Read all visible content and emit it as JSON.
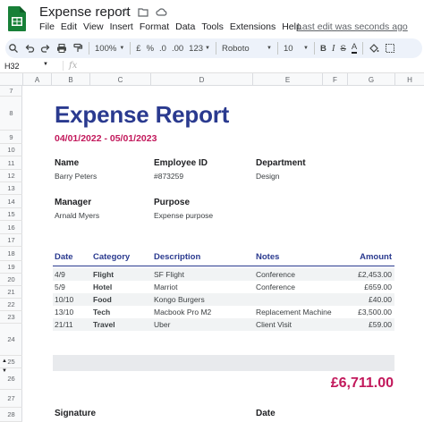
{
  "app": {
    "doc_title": "Expense report",
    "menu": [
      "File",
      "Edit",
      "View",
      "Insert",
      "Format",
      "Data",
      "Tools",
      "Extensions",
      "Help"
    ],
    "last_edit": "Last edit was seconds ago"
  },
  "toolbar": {
    "zoom": "100%",
    "currency": "£",
    "percent": "%",
    "dec_decrease": ".0",
    "dec_increase": ".00",
    "format_more": "123",
    "font": "Roboto",
    "font_size": "10",
    "bold": "B",
    "italic": "I",
    "strike": "S",
    "text_color": "A"
  },
  "formula_bar": {
    "cell_ref": "H32",
    "fx": "fx"
  },
  "columns": [
    "A",
    "B",
    "C",
    "D",
    "E",
    "F",
    "G",
    "H"
  ],
  "rows": [
    "7",
    "8",
    "9",
    "10",
    "11",
    "12",
    "13",
    "14",
    "15",
    "16",
    "17",
    "18",
    "19",
    "20",
    "21",
    "22",
    "23",
    "24",
    "25",
    "26",
    "27",
    "28"
  ],
  "report": {
    "title": "Expense Report",
    "date_range": "04/01/2022 - 05/01/2023",
    "name_label": "Name",
    "name_value": "Barry Peters",
    "employee_id_label": "Employee ID",
    "employee_id_value": "#873259",
    "department_label": "Department",
    "department_value": "Design",
    "manager_label": "Manager",
    "manager_value": "Arnald Myers",
    "purpose_label": "Purpose",
    "purpose_value": "Expense purpose",
    "table_headers": {
      "date": "Date",
      "category": "Category",
      "description": "Description",
      "notes": "Notes",
      "amount": "Amount"
    },
    "items": [
      {
        "date": "4/9",
        "category": "Flight",
        "description": "SF Flight",
        "notes": "Conference",
        "amount": "£2,453.00"
      },
      {
        "date": "5/9",
        "category": "Hotel",
        "description": "Marriot",
        "notes": "Conference",
        "amount": "£659.00"
      },
      {
        "date": "10/10",
        "category": "Food",
        "description": "Kongo Burgers",
        "notes": "",
        "amount": "£40.00"
      },
      {
        "date": "13/10",
        "category": "Tech",
        "description": "Macbook Pro M2",
        "notes": "Replacement Machine",
        "amount": "£3,500.00"
      },
      {
        "date": "21/11",
        "category": "Travel",
        "description": "Uber",
        "notes": "Client Visit",
        "amount": "£59.00"
      }
    ],
    "total": "£6,711.00",
    "signature_label": "Signature",
    "date_label": "Date"
  },
  "colors": {
    "title_blue": "#2a3a8f",
    "accent_pink": "#c2185b",
    "sheets_green": "#188038"
  }
}
